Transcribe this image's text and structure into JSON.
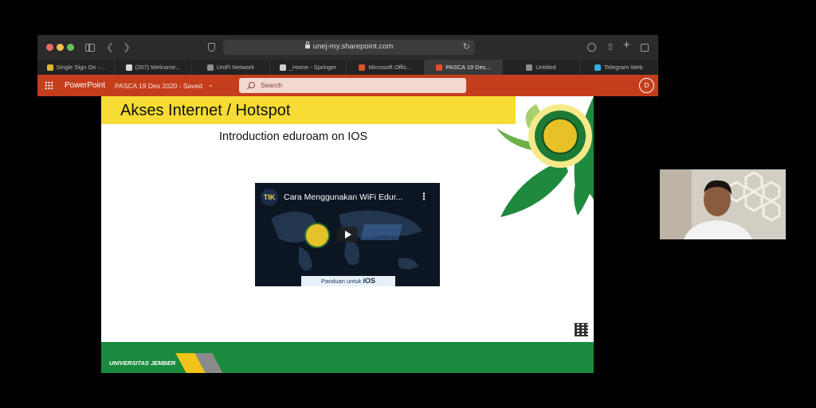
{
  "browser": {
    "url": "unej-my.sharepoint.com",
    "tabs": [
      {
        "label": "Single Sign On -...",
        "color": "#e0b52a"
      },
      {
        "label": "(207) Welcome...",
        "color": "#d9d9d9"
      },
      {
        "label": "UniFi Network",
        "color": "#8d8d8d"
      },
      {
        "label": "_Home - Springer",
        "color": "#cfcfcf"
      },
      {
        "label": "Microsoft Offic...",
        "color": "#e1502d"
      },
      {
        "label": "PASCA 19 Des...",
        "color": "#e1502d"
      },
      {
        "label": "Untitled",
        "color": "#8d8d8d"
      },
      {
        "label": "Telegram Web",
        "color": "#37aee2"
      }
    ],
    "active_tab": 5
  },
  "office": {
    "app_name": "PowerPoint",
    "doc_title": "PASCA 19 Des 2020  -  Saved",
    "search_placeholder": "Search",
    "avatar_initial": "D"
  },
  "slide": {
    "title": "Akses Internet / Hotspot",
    "subtitle": "Introduction eduroam on IOS",
    "video": {
      "channel_initials": "TIK",
      "title": "Cara Menggunakan WiFi Edur...",
      "banner_prefix": "Panduan untuk",
      "banner_os": "iOS"
    },
    "footer": "UNIVERSITAS JEMBER"
  },
  "colors": {
    "office_accent": "#c43e1c",
    "title_band": "#f6dc35",
    "footer_green": "#1a8a3e"
  }
}
